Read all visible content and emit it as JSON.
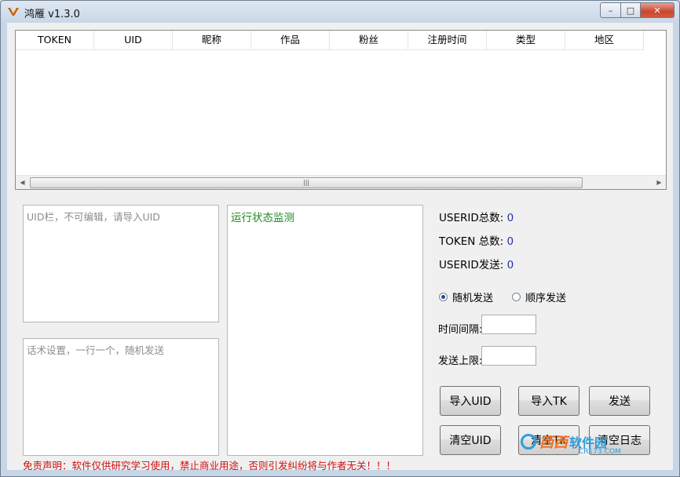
{
  "window": {
    "title": "鸿雁 v1.3.0",
    "controls": {
      "minimize": "–",
      "maximize": "□",
      "close": "✕"
    }
  },
  "table": {
    "columns": [
      "TOKEN",
      "UID",
      "昵称",
      "作品",
      "粉丝",
      "注册时间",
      "类型",
      "地区"
    ],
    "rows": []
  },
  "uid_box": {
    "placeholder": "UID栏，不可编辑，请导入UID"
  },
  "script_box": {
    "placeholder": "话术设置，一行一个，随机发送"
  },
  "monitor": {
    "title": "运行状态监测"
  },
  "stats": {
    "userid_total": {
      "label": "USERID总数:",
      "value": "0"
    },
    "token_total": {
      "label": "TOKEN 总数:",
      "value": "0"
    },
    "userid_sent": {
      "label": "USERID发送:",
      "value": "0"
    }
  },
  "mode": {
    "random": "随机发送",
    "sequential": "顺序发送",
    "selected": "random"
  },
  "fields": {
    "interval_label": "时间间隔:",
    "limit_label": "发送上限:"
  },
  "buttons": {
    "import_uid": "导入UID",
    "import_tk": "导入TK",
    "send": "发送",
    "clear_uid": "清空UID",
    "clear_tk": "清空TK",
    "clear_log": "清空日志"
  },
  "disclaimer": "免责声明：软件仅供研究学习使用，禁止商业用途，否则引发纠纷将与作者无关！！！",
  "watermark": {
    "text1": "西西",
    "text2": "软件园",
    "sub": "CR173.COM"
  },
  "colors": {
    "accent_value": "#2233aa",
    "monitor_text": "#1c8a1c",
    "disclaimer": "#d01010"
  }
}
